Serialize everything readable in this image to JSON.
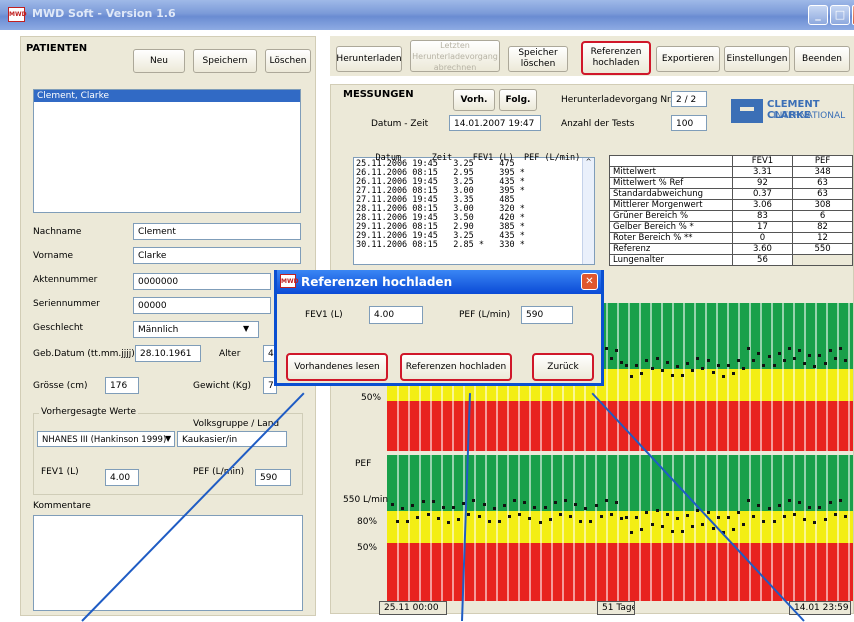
{
  "window": {
    "title": "MWD Soft - Version 1.6",
    "app_icon_text": "MWD"
  },
  "patients": {
    "header": "PATIENTEN",
    "buttons": {
      "new": "Neu",
      "save": "Speichern",
      "delete": "Löschen"
    },
    "list": [
      "Clement, Clarke"
    ],
    "labels": {
      "last_name": "Nachname",
      "first_name": "Vorname",
      "file_no": "Aktennummer",
      "serial_no": "Seriennummer",
      "gender": "Geschlecht",
      "dob": "Geb.Datum (tt.mm.jjjj)",
      "age": "Alter",
      "height": "Grösse (cm)",
      "weight": "Gewicht (Kg)",
      "predicted": "Vorhergesagte Werte",
      "ethnic": "Volksgruppe / Land",
      "fev1": "FEV1 (L)",
      "pef": "PEF (L/min)",
      "comments": "Kommentare"
    },
    "values": {
      "last_name": "Clement",
      "first_name": "Clarke",
      "file_no": "0000000",
      "serial_no": "00000",
      "gender": "Männlich",
      "dob": "28.10.1961",
      "age": "4",
      "height": "176",
      "weight": "7",
      "predicted": "NHANES III (Hankinson 1999)",
      "ethnic": "Kaukasier/in",
      "fev1": "4.00",
      "pef": "590"
    }
  },
  "toolbar": {
    "download": "Herunterladen",
    "last_download": "Letzten Herunterladevorgang abrechnen",
    "clear_memory": "Speicher löschen",
    "upload_refs": "Referenzen hochladen",
    "export": "Exportieren",
    "settings": "Einstellungen",
    "quit": "Beenden"
  },
  "measurements": {
    "header": "MESSUNGEN",
    "prev": "Vorh.",
    "next": "Folg.",
    "download_no_label": "Herunterladevorgang Nr.",
    "download_no": "2 / 2",
    "datetime_label": "Datum - Zeit",
    "datetime": "14.01.2007  19:47",
    "tests_label": "Anzahl der Tests",
    "tests": "100",
    "columns": [
      "Datum",
      "Zeit",
      "FEV1 (L)",
      "PEF (L/min)"
    ],
    "rows": [
      [
        "25.11.2006",
        "19:45",
        "3.25",
        "475"
      ],
      [
        "26.11.2006",
        "08:15",
        "2.95",
        "395 *"
      ],
      [
        "26.11.2006",
        "19:45",
        "3.25",
        "435 *"
      ],
      [
        "27.11.2006",
        "08:15",
        "3.00",
        "395 *"
      ],
      [
        "27.11.2006",
        "19:45",
        "3.35",
        "485"
      ],
      [
        "28.11.2006",
        "08:15",
        "3.00",
        "320 *"
      ],
      [
        "28.11.2006",
        "19:45",
        "3.50",
        "420 *"
      ],
      [
        "29.11.2006",
        "08:15",
        "2.90",
        "385 *"
      ],
      [
        "29.11.2006",
        "19:45",
        "3.25",
        "435 *"
      ],
      [
        "30.11.2006",
        "08:15",
        "2.85 *",
        "330 *"
      ]
    ]
  },
  "logo": {
    "name": "CLEMENT CLARKE",
    "sub": "INTERNATIONAL"
  },
  "stats": {
    "columns": [
      "",
      "FEV1",
      "PEF"
    ],
    "rows": [
      [
        "Mittelwert",
        "3.31",
        "348"
      ],
      [
        "Mittelwert % Ref",
        "92",
        "63"
      ],
      [
        "Standardabweichung",
        "0.37",
        "63"
      ],
      [
        "Mittlerer Morgenwert",
        "3.06",
        "308"
      ],
      [
        "Grüner Bereich %",
        "83",
        "6"
      ],
      [
        "Gelber Bereich %",
        "17",
        "82"
      ],
      [
        "Roter Bereich %",
        "0",
        "12"
      ],
      [
        "Referenz",
        "3.60",
        "550"
      ],
      [
        "Lungenalter",
        "56",
        ""
      ]
    ],
    "yellow_marker": "*",
    "red_marker": "**"
  },
  "charts": {
    "upper_pct": "50%",
    "pef_label": "PEF",
    "pef_ref": "550 L/min",
    "pct80": "80%",
    "pct50": "50%",
    "start": "25.11 00:00",
    "span": "51 Tage",
    "end": "14.01 23:59"
  },
  "dialog": {
    "title": "Referenzen hochladen",
    "fev1_label": "FEV1 (L)",
    "fev1": "4.00",
    "pef_label": "PEF (L/min)",
    "pef": "590",
    "read": "Vorhandenes lesen",
    "upload": "Referenzen hochladen",
    "back": "Zurück"
  },
  "colors": {
    "green": "#19a04a",
    "yellow": "#f3ee14",
    "red": "#e8231f",
    "highlight": "#d0172a",
    "callout": "#1f5cc4"
  }
}
